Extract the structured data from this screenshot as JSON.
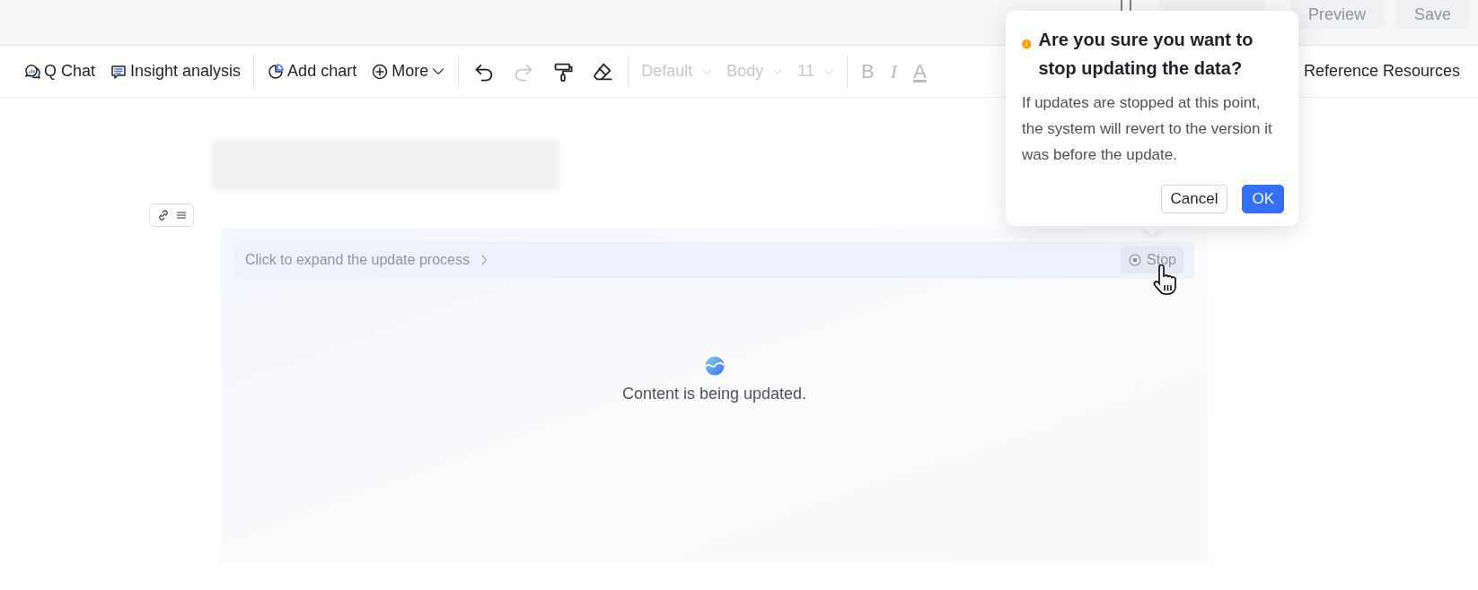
{
  "top_bar": {
    "buttons": [
      {
        "label": "Preview"
      },
      {
        "label": "Save"
      }
    ]
  },
  "toolbar": {
    "groups": [
      [
        {
          "kind": "qchat",
          "label": "Q Chat"
        },
        {
          "kind": "insight",
          "label": "Insight analysis"
        }
      ],
      [
        {
          "kind": "addchart",
          "label": "Add chart"
        },
        {
          "kind": "more",
          "label": "More"
        }
      ],
      [
        {
          "kind": "undo",
          "disabled": false
        },
        {
          "kind": "redo",
          "disabled": true
        },
        {
          "kind": "painter",
          "disabled": false
        },
        {
          "kind": "eraser",
          "disabled": false
        }
      ],
      [
        {
          "kind": "dropdown",
          "label": "Default",
          "disabled": true
        },
        {
          "kind": "dropdown",
          "label": "Body",
          "disabled": true
        },
        {
          "kind": "dropdown",
          "label": "11",
          "disabled": true
        }
      ],
      [
        {
          "kind": "bold",
          "label": "B",
          "disabled": true
        },
        {
          "kind": "italic",
          "label": "I",
          "disabled": true
        },
        {
          "kind": "color",
          "label": "A",
          "disabled": true
        }
      ]
    ],
    "right_link": "Reference Resources"
  },
  "update_panel": {
    "expand_label": "Click to expand the update process",
    "stop_label": "Stop",
    "status": "Content is being updated."
  },
  "popover": {
    "title": "Are you sure you want to stop updating the data?",
    "message": "If updates are stopped at this point, the system will revert to the version it was before the update.",
    "buttons": [
      {
        "label": "Cancel",
        "kind": "secondary"
      },
      {
        "label": "OK",
        "kind": "primary"
      }
    ]
  }
}
